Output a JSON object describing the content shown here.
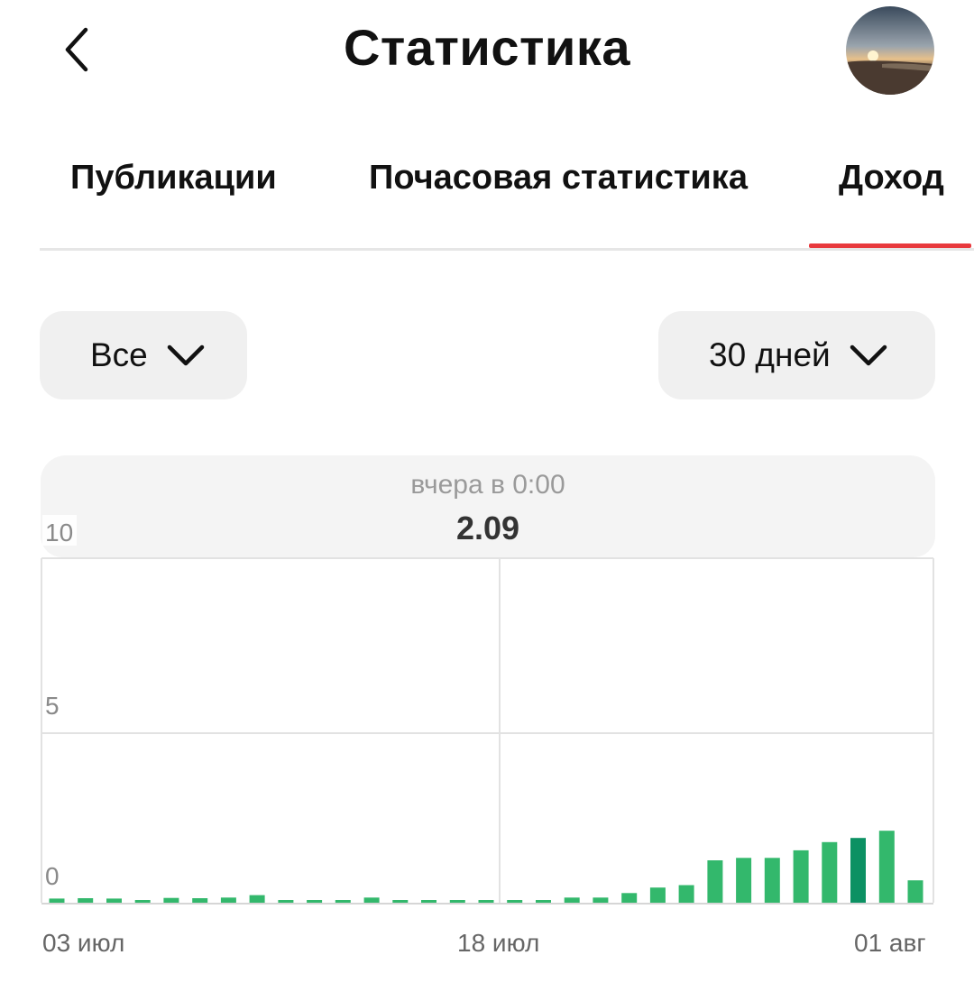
{
  "header": {
    "title": "Статистика",
    "back_icon": "chevron-left-icon",
    "avatar": "avatar"
  },
  "tabs": [
    {
      "label": "Публикации",
      "active": false
    },
    {
      "label": "Почасовая статистика",
      "active": false
    },
    {
      "label": "Доход",
      "active": true
    }
  ],
  "filters": {
    "type": {
      "value": "Все",
      "icon": "chevron-down-icon"
    },
    "period": {
      "value": "30 дней",
      "icon": "chevron-down-icon"
    }
  },
  "tooltip": {
    "time": "вчера в 0:00",
    "value": "2.09"
  },
  "colors": {
    "accent": "#e8393d",
    "bar": "#33b86c",
    "bar_selected": "#0c9163",
    "grid": "#e2e2e2"
  },
  "chart_data": {
    "type": "bar",
    "title": "",
    "xlabel": "",
    "ylabel": "",
    "ylim": [
      0,
      10
    ],
    "yticks": [
      "10",
      "5",
      "0"
    ],
    "x_tick_labels": [
      "03 июл",
      "18 июл",
      "01 авг"
    ],
    "grid": true,
    "selected_index": 28,
    "categories": [
      "03 июл",
      "04 июл",
      "05 июл",
      "06 июл",
      "07 июл",
      "08 июл",
      "09 июл",
      "10 июл",
      "11 июл",
      "12 июл",
      "13 июл",
      "14 июл",
      "15 июл",
      "16 июл",
      "17 июл",
      "18 июл",
      "19 июл",
      "20 июл",
      "21 июл",
      "22 июл",
      "23 июл",
      "24 июл",
      "25 июл",
      "26 июл",
      "27 июл",
      "28 июл",
      "29 июл",
      "30 июл",
      "31 июл",
      "01 авг"
    ],
    "values": [
      0.12,
      0.13,
      0.12,
      0.07,
      0.14,
      0.13,
      0.15,
      0.22,
      0.07,
      0.07,
      0.07,
      0.15,
      0.07,
      0.07,
      0.07,
      0.07,
      0.07,
      0.07,
      0.15,
      0.15,
      0.28,
      0.44,
      0.51,
      1.23,
      1.3,
      1.3,
      1.52,
      1.76,
      1.88,
      2.09,
      0.65
    ]
  }
}
